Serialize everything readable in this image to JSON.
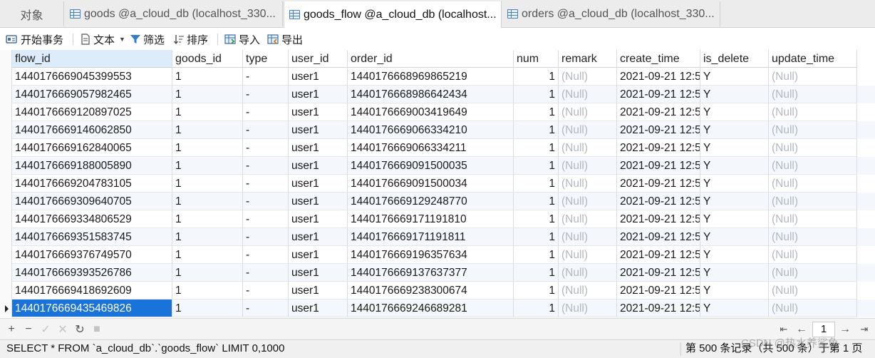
{
  "tabs": [
    {
      "label": "对象",
      "icon": "none"
    },
    {
      "label": "goods @a_cloud_db (localhost_330...",
      "icon": "table-icon"
    },
    {
      "label": "goods_flow @a_cloud_db (localhost...",
      "icon": "table-icon"
    },
    {
      "label": "orders @a_cloud_db (localhost_330...",
      "icon": "table-icon"
    }
  ],
  "toolbar": {
    "begin_transaction": "开始事务",
    "text": "文本",
    "filter": "筛选",
    "sort": "排序",
    "import": "导入",
    "export": "导出"
  },
  "grid": {
    "columns": [
      "flow_id",
      "goods_id",
      "type",
      "user_id",
      "order_id",
      "num",
      "remark",
      "create_time",
      "is_delete",
      "update_time"
    ],
    "rows": [
      [
        "1440176669045399553",
        "1",
        "-",
        "user1",
        "1440176668969865219",
        "1",
        "(Null)",
        "2021-09-21 12:5",
        "Y",
        "(Null)"
      ],
      [
        "1440176669057982465",
        "1",
        "-",
        "user1",
        "1440176668986642434",
        "1",
        "(Null)",
        "2021-09-21 12:5",
        "Y",
        "(Null)"
      ],
      [
        "1440176669120897025",
        "1",
        "-",
        "user1",
        "1440176669003419649",
        "1",
        "(Null)",
        "2021-09-21 12:5",
        "Y",
        "(Null)"
      ],
      [
        "1440176669146062850",
        "1",
        "-",
        "user1",
        "1440176669066334210",
        "1",
        "(Null)",
        "2021-09-21 12:5",
        "Y",
        "(Null)"
      ],
      [
        "1440176669162840065",
        "1",
        "-",
        "user1",
        "1440176669066334211",
        "1",
        "(Null)",
        "2021-09-21 12:5",
        "Y",
        "(Null)"
      ],
      [
        "1440176669188005890",
        "1",
        "-",
        "user1",
        "1440176669091500035",
        "1",
        "(Null)",
        "2021-09-21 12:5",
        "Y",
        "(Null)"
      ],
      [
        "1440176669204783105",
        "1",
        "-",
        "user1",
        "1440176669091500034",
        "1",
        "(Null)",
        "2021-09-21 12:5",
        "Y",
        "(Null)"
      ],
      [
        "1440176669309640705",
        "1",
        "-",
        "user1",
        "1440176669129248770",
        "1",
        "(Null)",
        "2021-09-21 12:5",
        "Y",
        "(Null)"
      ],
      [
        "1440176669334806529",
        "1",
        "-",
        "user1",
        "1440176669171191810",
        "1",
        "(Null)",
        "2021-09-21 12:5",
        "Y",
        "(Null)"
      ],
      [
        "1440176669351583745",
        "1",
        "-",
        "user1",
        "1440176669171191811",
        "1",
        "(Null)",
        "2021-09-21 12:5",
        "Y",
        "(Null)"
      ],
      [
        "1440176669376749570",
        "1",
        "-",
        "user1",
        "1440176669196357634",
        "1",
        "(Null)",
        "2021-09-21 12:5",
        "Y",
        "(Null)"
      ],
      [
        "1440176669393526786",
        "1",
        "-",
        "user1",
        "1440176669137637377",
        "1",
        "(Null)",
        "2021-09-21 12:5",
        "Y",
        "(Null)"
      ],
      [
        "1440176669418692609",
        "1",
        "-",
        "user1",
        "1440176669238300674",
        "1",
        "(Null)",
        "2021-09-21 12:5",
        "Y",
        "(Null)"
      ],
      [
        "1440176669435469826",
        "1",
        "-",
        "user1",
        "1440176669246689281",
        "1",
        "(Null)",
        "2021-09-21 12:5",
        "Y",
        "(Null)"
      ]
    ],
    "selected_row": 13
  },
  "gridbar": {
    "icons": [
      "add-record-icon",
      "delete-record-icon",
      "apply-icon",
      "discard-icon",
      "refresh-icon",
      "stop-icon",
      "first-page-icon",
      "prev-page-icon",
      "next-page-icon",
      "last-page-icon"
    ],
    "page": "1"
  },
  "status": {
    "sql": "SELECT * FROM `a_cloud_db`.`goods_flow` LIMIT 0,1000",
    "records": "第 500 条记录（共 500 条）于第 1 页"
  },
  "watermark": "CSDN @热水养鲨鱼",
  "colors": {
    "selection": "#1a73d9",
    "null_text": "#b3b8bf",
    "accent": "#2f6fb5"
  }
}
